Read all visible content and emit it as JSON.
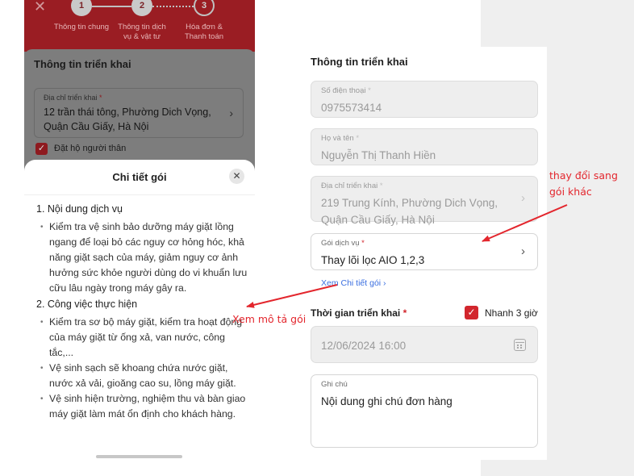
{
  "left_screen": {
    "close_glyph": "✕",
    "steps": [
      {
        "number": "1",
        "label": "Thông tin chung"
      },
      {
        "number": "2",
        "label": "Thông tin dịch vụ & vật tư"
      },
      {
        "number": "3",
        "label": "Hóa đơn & Thanh toán"
      }
    ],
    "section_title": "Thông tin triển khai",
    "address_label": "Địa chỉ triển khai",
    "address_value": "12 trần thái tông, Phường Dich Vọng, Quận Cầu Giấy, Hà Nội",
    "proxy_checkbox_label": "Đặt hộ người thân",
    "sheet": {
      "title": "Chi tiết gói",
      "close_glyph": "✕",
      "sections": [
        {
          "heading": "1. Nội dung dịch vụ",
          "bullets": [
            "Kiểm tra vệ sinh bảo dưỡng máy giặt lồng ngang để loại bỏ các nguy cơ hỏng hóc, khả năng giặt sạch của máy, giảm nguy cơ ảnh hưởng sức khỏe người dùng do vi khuẩn lưu cữu lâu ngày trong máy gây ra."
          ]
        },
        {
          "heading": "2. Công việc thực hiện",
          "bullets": [
            "Kiểm tra sơ bộ máy giặt, kiểm tra hoạt động của máy giặt từ ống xả, van nước, công tắc,...",
            "Vệ sinh sạch sẽ khoang chứa nước giặt, nước xả vải, gioăng cao su, lồng máy giặt.",
            "Vệ sinh hiện trường, nghiệm thu và bàn giao máy giặt làm mát ổn định cho khách hàng."
          ]
        }
      ]
    }
  },
  "right_screen": {
    "section_title": "Thông tin triển khai",
    "required_mark": "*",
    "phone": {
      "label": "Số điện thoại",
      "value": "0975573414"
    },
    "name": {
      "label": "Họ và tên",
      "value": "Nguyễn Thị Thanh Hiền"
    },
    "address": {
      "label": "Địa chỉ triển khai",
      "value": "219 Trung Kính, Phường Dich Vọng, Quận Cầu Giấy, Hà Nội"
    },
    "package": {
      "label": "Gói dịch vụ",
      "value": "Thay lõi lọc AIO 1,2,3"
    },
    "package_detail_link": "Xem Chi tiết gói",
    "deploy_time": {
      "label": "Thời gian triển khai",
      "value": "12/06/2024 16:00"
    },
    "fast_option_label": "Nhanh 3 giờ",
    "note": {
      "label": "Ghi chú",
      "value": "Nội dung ghi chú đơn hàng"
    }
  },
  "annotations": {
    "change_package": "thay đổi sang gói khác",
    "view_description": "Xem mô tả gói"
  },
  "colors": {
    "brand_red": "#d2262d",
    "annotation_red": "#e3262d",
    "link_blue": "#3b6fe0"
  }
}
